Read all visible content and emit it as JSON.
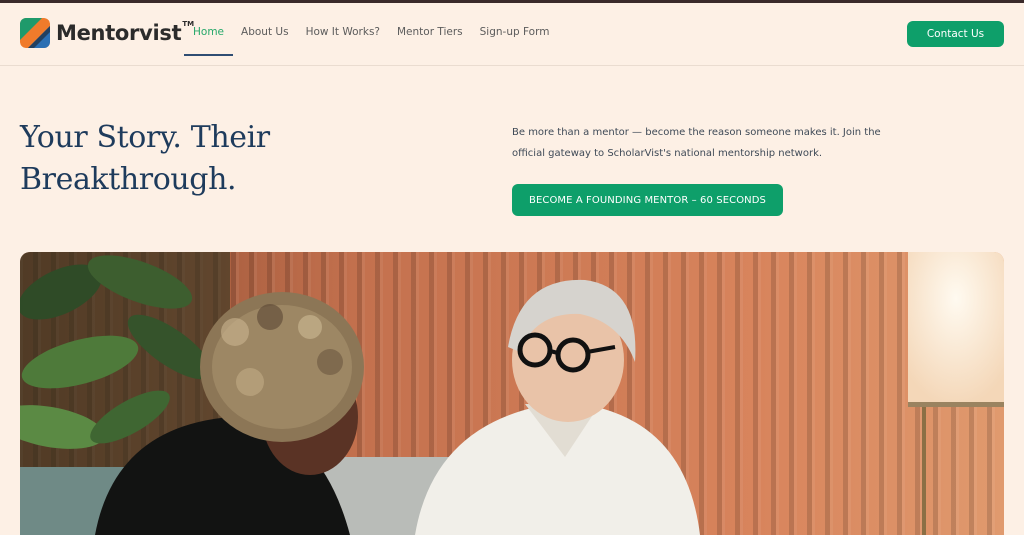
{
  "brand": {
    "name": "Mentorvist",
    "trademark": "TM"
  },
  "nav": {
    "items": [
      {
        "label": "Home",
        "active": true
      },
      {
        "label": "About Us",
        "active": false
      },
      {
        "label": "How It Works?",
        "active": false
      },
      {
        "label": "Mentor Tiers",
        "active": false
      },
      {
        "label": "Sign-up Form",
        "active": false
      }
    ]
  },
  "header": {
    "contact_label": "Contact Us"
  },
  "hero": {
    "title": "Your Story. Their Breakthrough.",
    "description": "Be more than a mentor — become the reason someone makes it. Join the official gateway to ScholarVist's national mentorship network.",
    "cta_label": "BECOME A FOUNDING MENTOR – 60 SECONDS"
  },
  "colors": {
    "background": "#fdf0e5",
    "accent_green": "#0e9f6a",
    "nav_active": "#26a86a",
    "heading_navy": "#1e3b5c"
  }
}
